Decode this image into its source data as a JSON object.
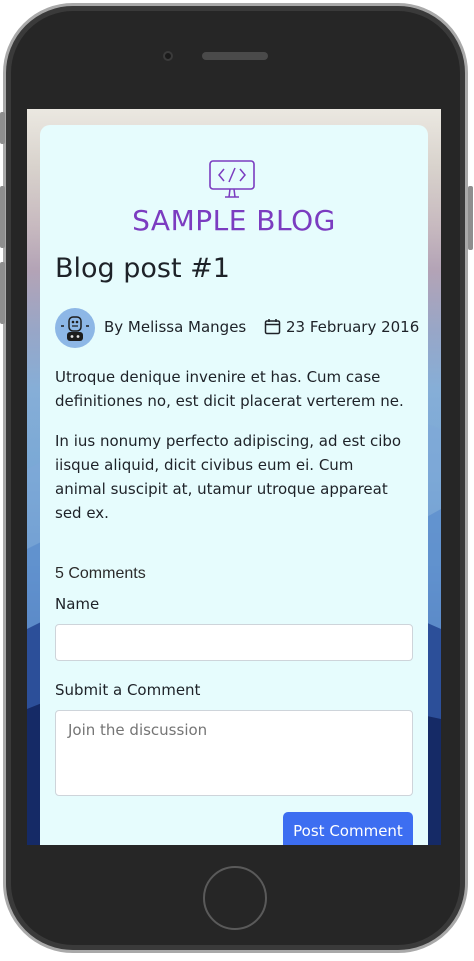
{
  "blog": {
    "brand": "SAMPLE BLOG",
    "brand_color": "#7b3cc0",
    "logo_icon": "monitor-code-icon"
  },
  "post": {
    "title": "Blog post #1",
    "author": "By Melissa Manges",
    "date": "23 February 2016",
    "paragraphs": [
      "Utroque denique invenire et has. Cum case definitiones no, est dicit placerat verterem ne.",
      "In ius nonumy perfecto adipiscing, ad est cibo iisque aliquid, dicit civibus eum ei. Cum animal suscipit at, utamur utroque appareat sed ex."
    ]
  },
  "comments": {
    "count_label": "5 Comments",
    "name_label": "Name",
    "name_value": "",
    "comment_label": "Submit a Comment",
    "comment_placeholder": "Join the discussion",
    "submit_label": "Post Comment",
    "submit_color": "#3d6ef1"
  }
}
